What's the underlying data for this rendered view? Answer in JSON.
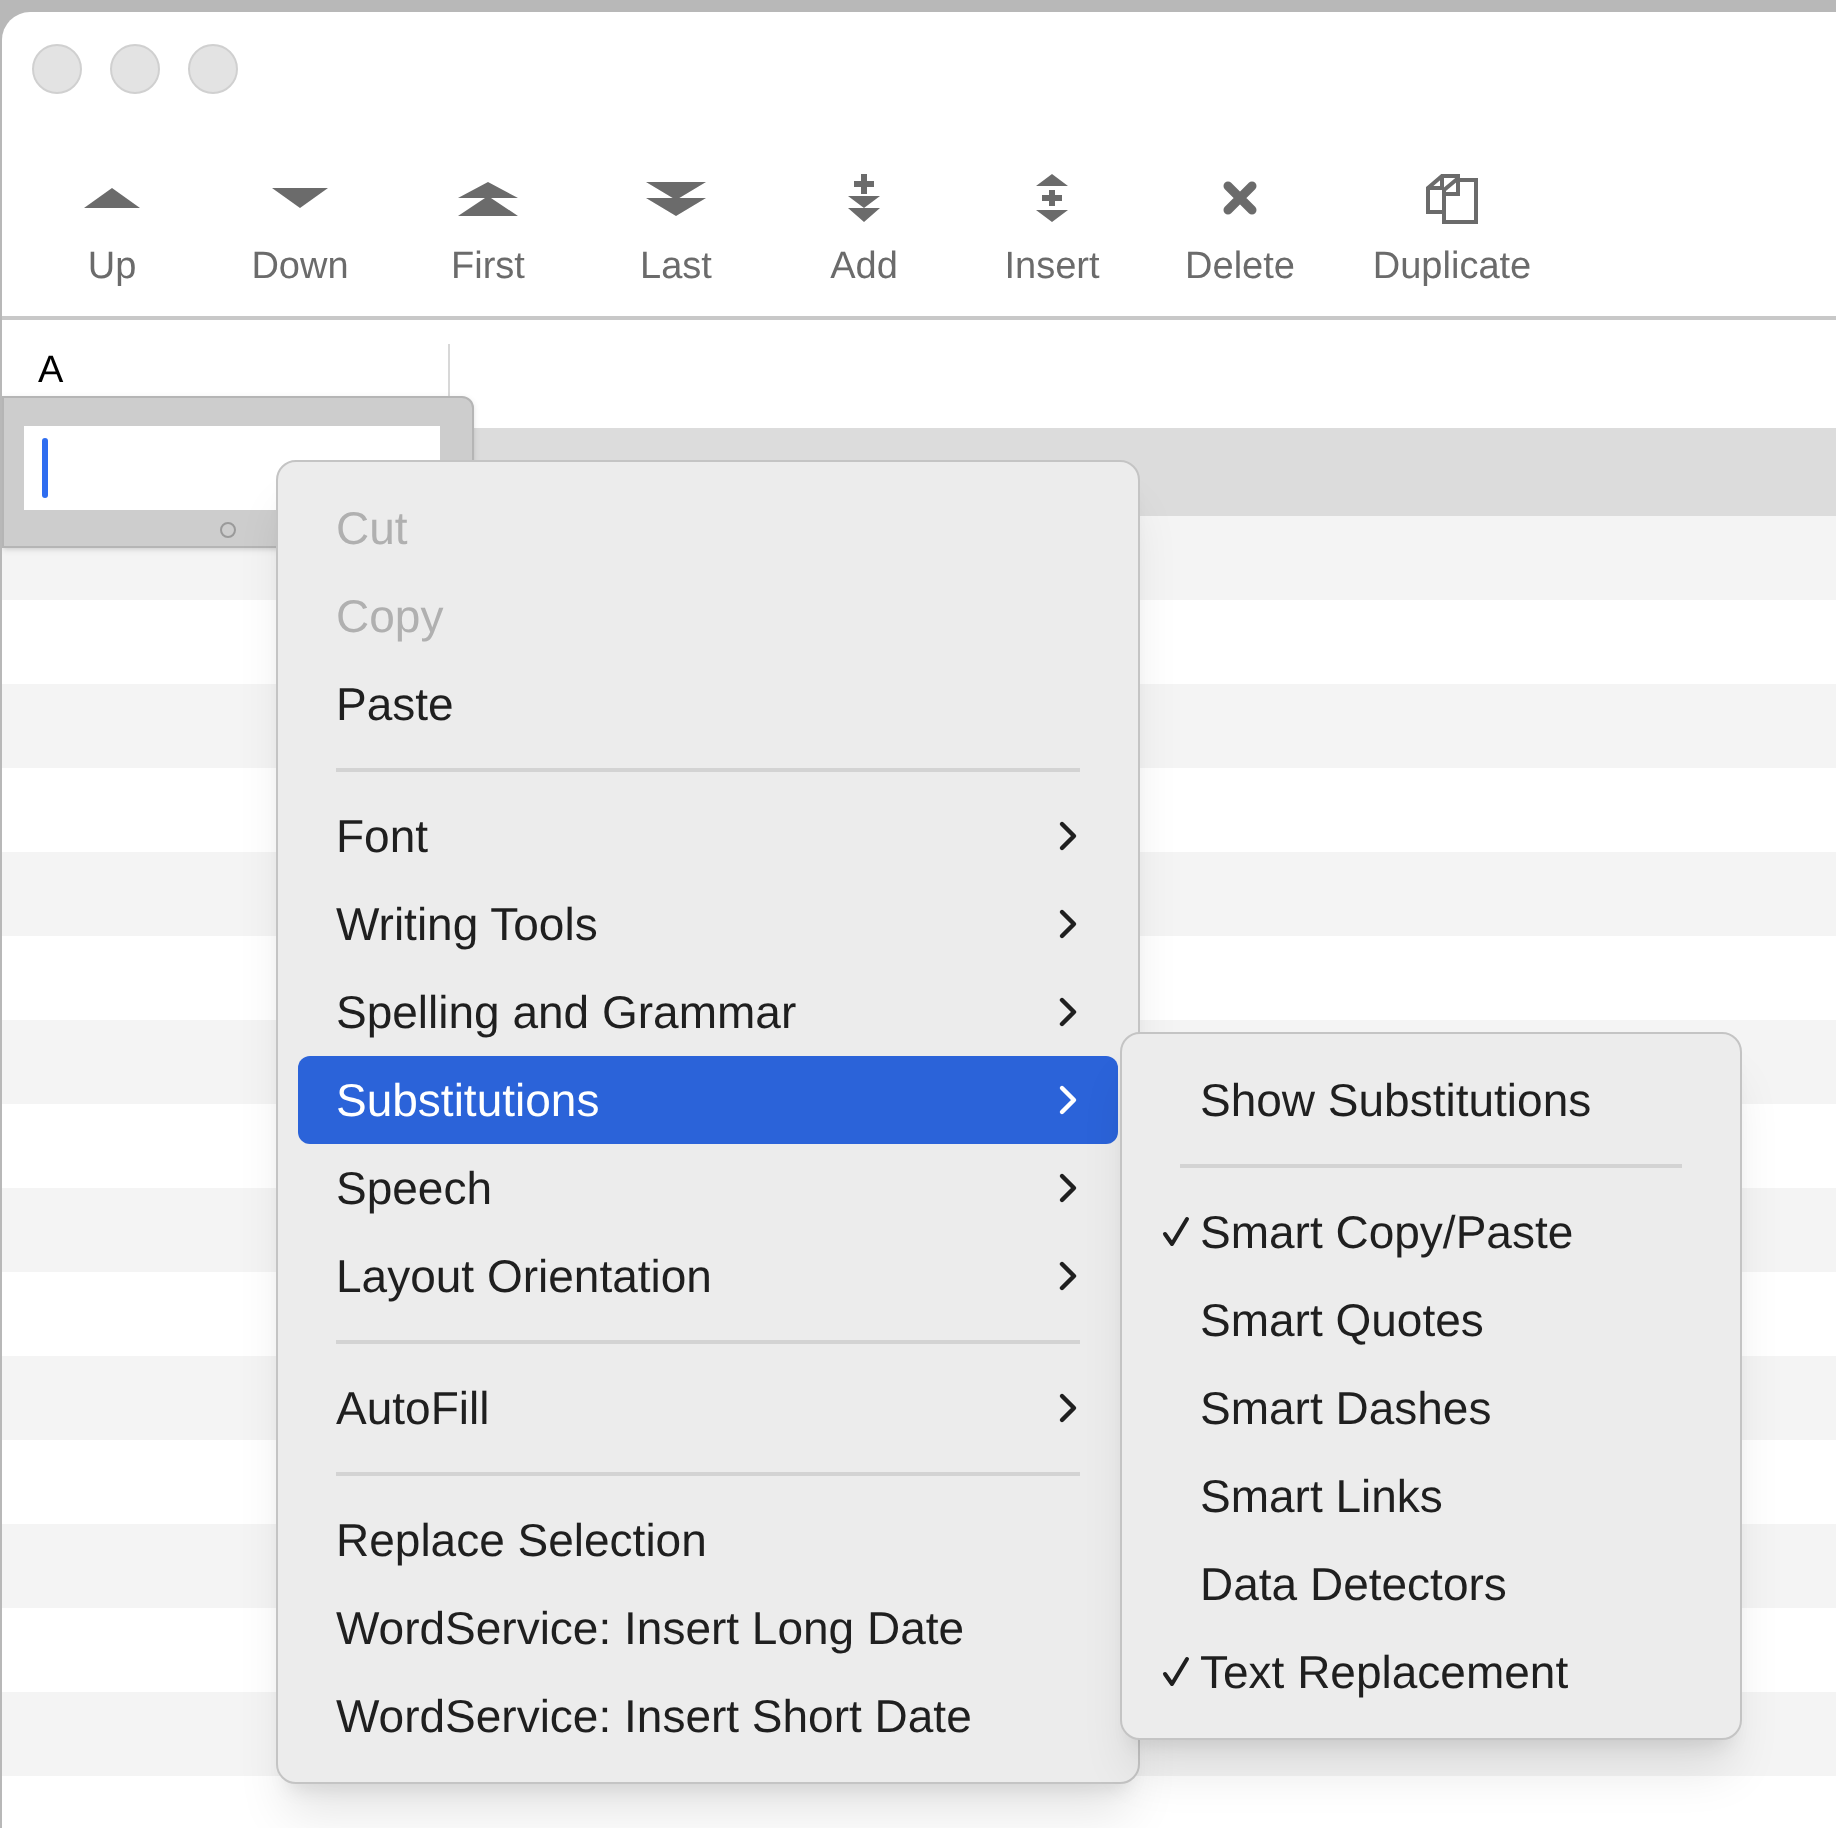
{
  "toolbar": [
    {
      "label": "Up"
    },
    {
      "label": "Down"
    },
    {
      "label": "First"
    },
    {
      "label": "Last"
    },
    {
      "label": "Add"
    },
    {
      "label": "Insert"
    },
    {
      "label": "Delete"
    },
    {
      "label": "Duplicate"
    }
  ],
  "table": {
    "columns": [
      {
        "label": "A"
      }
    ]
  },
  "context_menu": [
    {
      "kind": "item",
      "label": "Cut",
      "disabled": true,
      "selected": false,
      "submenu": false
    },
    {
      "kind": "item",
      "label": "Copy",
      "disabled": true,
      "selected": false,
      "submenu": false
    },
    {
      "kind": "item",
      "label": "Paste",
      "disabled": false,
      "selected": false,
      "submenu": false
    },
    {
      "kind": "separator"
    },
    {
      "kind": "item",
      "label": "Font",
      "disabled": false,
      "selected": false,
      "submenu": true
    },
    {
      "kind": "item",
      "label": "Writing Tools",
      "disabled": false,
      "selected": false,
      "submenu": true
    },
    {
      "kind": "item",
      "label": "Spelling and Grammar",
      "disabled": false,
      "selected": false,
      "submenu": true
    },
    {
      "kind": "item",
      "label": "Substitutions",
      "disabled": false,
      "selected": true,
      "submenu": true
    },
    {
      "kind": "item",
      "label": "Speech",
      "disabled": false,
      "selected": false,
      "submenu": true
    },
    {
      "kind": "item",
      "label": "Layout Orientation",
      "disabled": false,
      "selected": false,
      "submenu": true
    },
    {
      "kind": "separator"
    },
    {
      "kind": "item",
      "label": "AutoFill",
      "disabled": false,
      "selected": false,
      "submenu": true
    },
    {
      "kind": "separator"
    },
    {
      "kind": "item",
      "label": "Replace Selection",
      "disabled": false,
      "selected": false,
      "submenu": false
    },
    {
      "kind": "item",
      "label": "WordService: Insert Long Date",
      "disabled": false,
      "selected": false,
      "submenu": false
    },
    {
      "kind": "item",
      "label": "WordService: Insert Short Date",
      "disabled": false,
      "selected": false,
      "submenu": false
    }
  ],
  "submenu": [
    {
      "kind": "item",
      "label": "Show Substitutions",
      "checked": false
    },
    {
      "kind": "separator"
    },
    {
      "kind": "item",
      "label": "Smart Copy/Paste",
      "checked": true
    },
    {
      "kind": "item",
      "label": "Smart Quotes",
      "checked": false
    },
    {
      "kind": "item",
      "label": "Smart Dashes",
      "checked": false
    },
    {
      "kind": "item",
      "label": "Smart Links",
      "checked": false
    },
    {
      "kind": "item",
      "label": "Data Detectors",
      "checked": false
    },
    {
      "kind": "item",
      "label": "Text Replacement",
      "checked": true
    }
  ]
}
